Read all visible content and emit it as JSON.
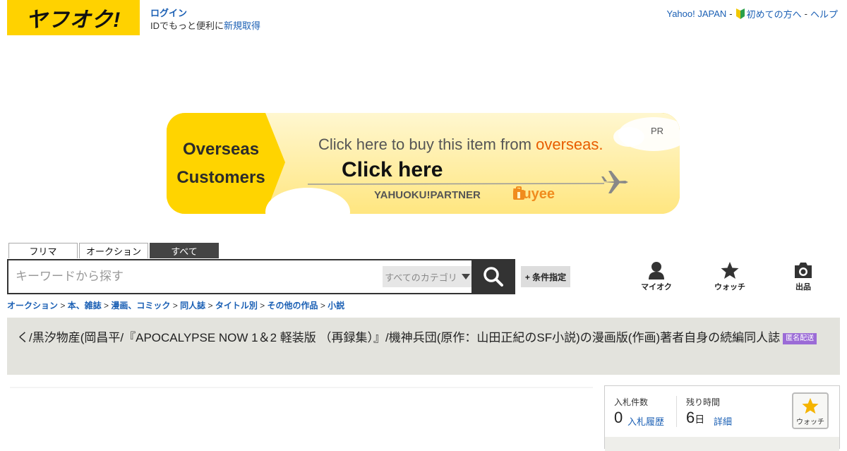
{
  "header": {
    "logo_text": "ヤフオク!",
    "login_label": "ログイン",
    "login_sub_prefix": "IDでもっと便利に",
    "register_label": "新規取得",
    "links": {
      "yahoo": "Yahoo! JAPAN",
      "beginner": "初めての方へ",
      "help": "ヘルプ",
      "separator": "-"
    }
  },
  "banner": {
    "left_text_line1": "Overseas",
    "left_text_line2": "Customers",
    "buy_text_prefix": "Click here to buy this item from ",
    "buy_text_highlight": "overseas.",
    "click_here": "Click here",
    "partner": "YAHUOKU!PARTNER",
    "buyee": "Buyee",
    "pr": "PR"
  },
  "tabs": [
    {
      "label": "フリマ",
      "active": false
    },
    {
      "label": "オークション",
      "active": false
    },
    {
      "label": "すべて",
      "active": true
    }
  ],
  "search": {
    "placeholder": "キーワードから探す",
    "category": "すべてのカテゴリ",
    "condition_button": "+ 条件指定"
  },
  "icon_nav": [
    {
      "label": "マイオク",
      "icon": "user-icon"
    },
    {
      "label": "ウォッチ",
      "icon": "star-icon"
    },
    {
      "label": "出品",
      "icon": "camera-icon"
    }
  ],
  "breadcrumb": [
    "オークション",
    "本、雑誌",
    "漫画、コミック",
    "同人誌",
    "タイトル別",
    "その他の作品",
    "小説"
  ],
  "item": {
    "title": "く/黒汐物産(岡昌平/『APOCALYPSE NOW 1＆2 軽装版 （再録集）』/機神兵団(原作：山田正紀のSF小説)の漫画版(作画)著者自身の続編同人誌",
    "badge": "匿名配送"
  },
  "bid_panel": {
    "bids_label": "入札件数",
    "bids_value": "0",
    "bid_history_link": "入札履歴",
    "remaining_label": "残り時間",
    "remaining_value": "6",
    "remaining_unit": "日",
    "detail_link": "詳細",
    "watch_label": "ウォッチ"
  },
  "colors": {
    "brand_yellow": "#ffd200",
    "link_blue": "#1a5fb4",
    "title_bg": "#e3e3dd",
    "badge_purple": "#9b6bd6",
    "buyee_orange": "#f08c1e"
  }
}
